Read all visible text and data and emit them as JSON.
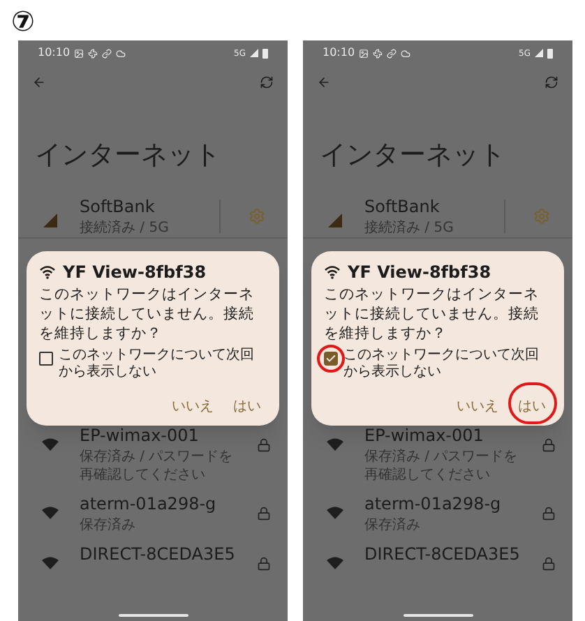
{
  "step_label": "⑦",
  "screens": [
    {
      "status_bar": {
        "time": "10:10",
        "network": "5G"
      },
      "title": "インターネット",
      "networks": [
        {
          "kind": "cellular",
          "name": "SoftBank",
          "status": "接続済み / 5G",
          "settings": true,
          "locked": false
        },
        {
          "kind": "wifi",
          "name": "EP-wimax-001",
          "status": "保存済み / パスワードを再確認してください",
          "settings": false,
          "locked": true
        },
        {
          "kind": "wifi",
          "name": "aterm-01a298-g",
          "status": "保存済み",
          "settings": false,
          "locked": true
        },
        {
          "kind": "wifi",
          "name": "DIRECT-8CEDA3E5",
          "settings": false,
          "locked": true
        }
      ],
      "dialog": {
        "title": "YF View-8fbf38",
        "message": "このネットワークはインターネットに接続していません。接続を維持しますか？",
        "checkbox": {
          "label": "このネットワークについて次回から表示しない",
          "checked": false,
          "circled": false
        },
        "buttons": [
          {
            "label": "いいえ",
            "circled": false
          },
          {
            "label": "はい",
            "circled": false
          }
        ]
      }
    },
    {
      "status_bar": {
        "time": "10:10",
        "network": "5G"
      },
      "title": "インターネット",
      "networks": [
        {
          "kind": "cellular",
          "name": "SoftBank",
          "status": "接続済み / 5G",
          "settings": true,
          "locked": false
        },
        {
          "kind": "wifi",
          "name": "EP-wimax-001",
          "status": "保存済み / パスワードを再確認してください",
          "settings": false,
          "locked": true
        },
        {
          "kind": "wifi",
          "name": "aterm-01a298-g",
          "status": "保存済み",
          "settings": false,
          "locked": true
        },
        {
          "kind": "wifi",
          "name": "DIRECT-8CEDA3E5",
          "settings": false,
          "locked": true
        }
      ],
      "dialog": {
        "title": "YF View-8fbf38",
        "message": "このネットワークはインターネットに接続していません。接続を維持しますか？",
        "checkbox": {
          "label": "このネットワークについて次回から表示しない",
          "checked": true,
          "circled": true
        },
        "buttons": [
          {
            "label": "いいえ",
            "circled": false
          },
          {
            "label": "はい",
            "circled": true
          }
        ]
      }
    }
  ]
}
